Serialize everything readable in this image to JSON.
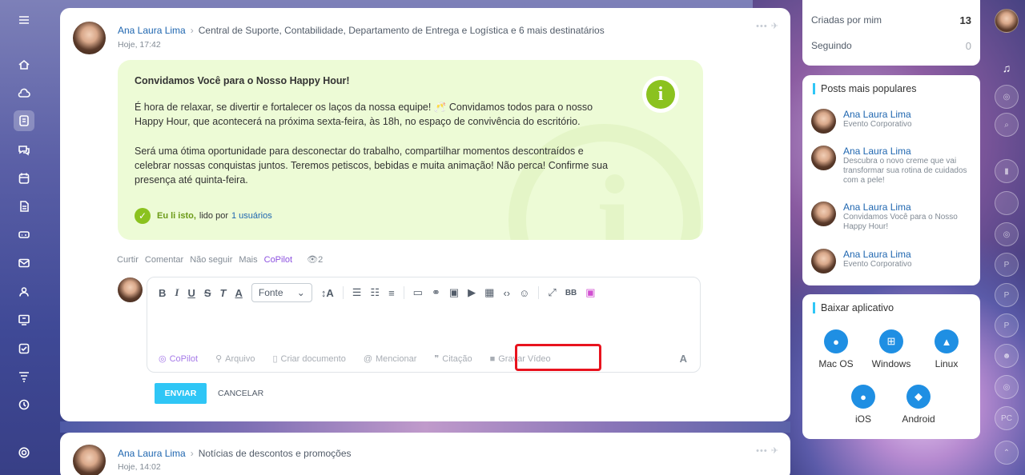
{
  "post1": {
    "author": "Ana Laura Lima",
    "destinations": "Central de Suporte, Contabilidade, Departamento de Entrega e Logística  e 6 mais destinatários",
    "time": "Hoje, 17:42",
    "title": "Convidamos Você para o Nosso Happy Hour!",
    "p1": "É hora de relaxar, se divertir e fortalecer os laços da nossa equipe! 🥂 Convidamos todos para o nosso Happy Hour, que acontecerá na próxima sexta-feira, às 18h, no espaço de convivência do escritório.",
    "p2": "Será uma ótima oportunidade para desconectar do trabalho, compartilhar momentos descontraídos e celebrar nossas conquistas juntos. Teremos petiscos, bebidas e muita animação! Não perca! Confirme sua presença até quinta-feira.",
    "read_ack": "Eu li isto,",
    "read_by": "lido por",
    "read_users": "1 usuários",
    "actions": [
      "Curtir",
      "Comentar",
      "Não seguir",
      "Mais",
      "CoPilot"
    ],
    "views": "2"
  },
  "editor": {
    "font": "Fonte",
    "bottom": {
      "copilot": "CoPilot",
      "file": "Arquivo",
      "doc": "Criar documento",
      "mention": "Mencionar",
      "quote": "Citação",
      "video": "Gravar Vídeo"
    },
    "send": "ENVIAR",
    "cancel": "CANCELAR"
  },
  "post2": {
    "author": "Ana Laura Lima",
    "destinations": "Notícias de descontos e promoções",
    "time": "Hoje, 14:02"
  },
  "right": {
    "created_label": "Criadas por mim",
    "created_count": "13",
    "following_label": "Seguindo",
    "following_count": "0",
    "popular_title": "Posts mais populares",
    "popular": [
      {
        "name": "Ana Laura Lima",
        "desc": "Evento Corporativo"
      },
      {
        "name": "Ana Laura Lima",
        "desc": "Descubra o novo creme que vai transformar sua rotina de cuidados com a pele!"
      },
      {
        "name": "Ana Laura Lima",
        "desc": "Convidamos Você para o Nosso Happy Hour!"
      },
      {
        "name": "Ana Laura Lima",
        "desc": "Evento Corporativo"
      }
    ],
    "apps_title": "Baixar aplicativo",
    "apps": [
      "Mac OS",
      "Windows",
      "Linux",
      "iOS",
      "Android"
    ]
  },
  "colors": {
    "accent": "#2fc6f6",
    "link": "#2067b0",
    "success": "#8bc21f",
    "highlight": "#e8131e"
  }
}
